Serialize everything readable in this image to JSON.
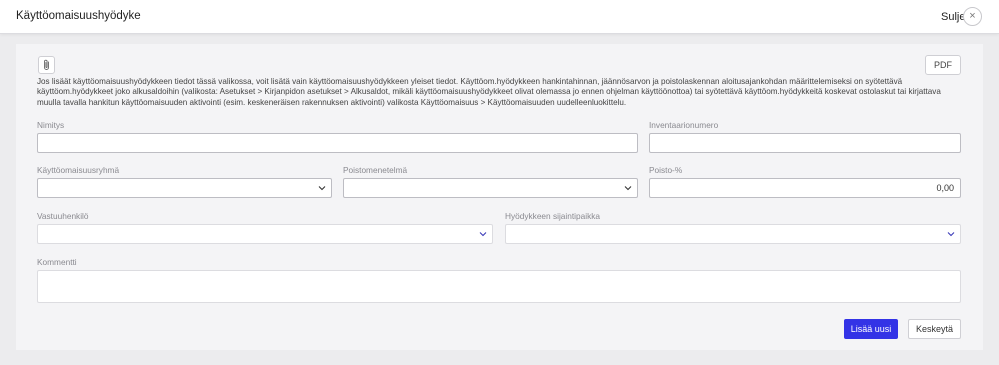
{
  "header": {
    "title": "Käyttöomaisuushyödyke",
    "close_label": "Sulje",
    "close_icon": "×"
  },
  "toolbar": {
    "attach_icon": "paperclip-icon",
    "pdf_label": "PDF"
  },
  "info_text": "Jos lisäät käyttöomaisuushyödykkeen tiedot tässä valikossa, voit lisätä vain käyttöomaisuushyödykkeen yleiset tiedot. Käyttöom.hyödykkeen hankintahinnan, jäännösarvon ja poistolaskennan aloitusajankohdan määrittelemiseksi on syötettävä käyttöom.hyödykkeet joko alkusaldoihin (valikosta: Asetukset > Kirjanpidon asetukset > Alkusaldot, mikäli käyttöomaisuushyödykkeet olivat olemassa jo ennen ohjelman käyttöönottoa) tai syötettävä käyttöom.hyödykkeitä koskevat ostolaskut tai kirjattava muulla tavalla hankitun käyttöomaisuuden aktivointi (esim. keskeneräisen rakennuksen aktivointi) valikosta Käyttöomaisuus > Käyttöomaisuuden uudelleenluokittelu.",
  "form": {
    "name_label": "Nimitys",
    "name_value": "",
    "inventory_label": "Inventaarionumero",
    "inventory_value": "",
    "group_label": "Käyttöomaisuusryhmä",
    "group_value": "",
    "method_label": "Poistomenetelmä",
    "method_value": "",
    "rate_label": "Poisto-%",
    "rate_value": "0,00",
    "responsible_label": "Vastuuhenkilö",
    "responsible_value": "",
    "location_label": "Hyödykkeen sijaintipaikka",
    "location_value": "",
    "comment_label": "Kommentti",
    "comment_value": ""
  },
  "actions": {
    "add_label": "Lisää uusi",
    "cancel_label": "Keskeytä"
  },
  "colors": {
    "primary": "#3333e6",
    "background": "#ececee",
    "panel": "#f4f4f6"
  }
}
